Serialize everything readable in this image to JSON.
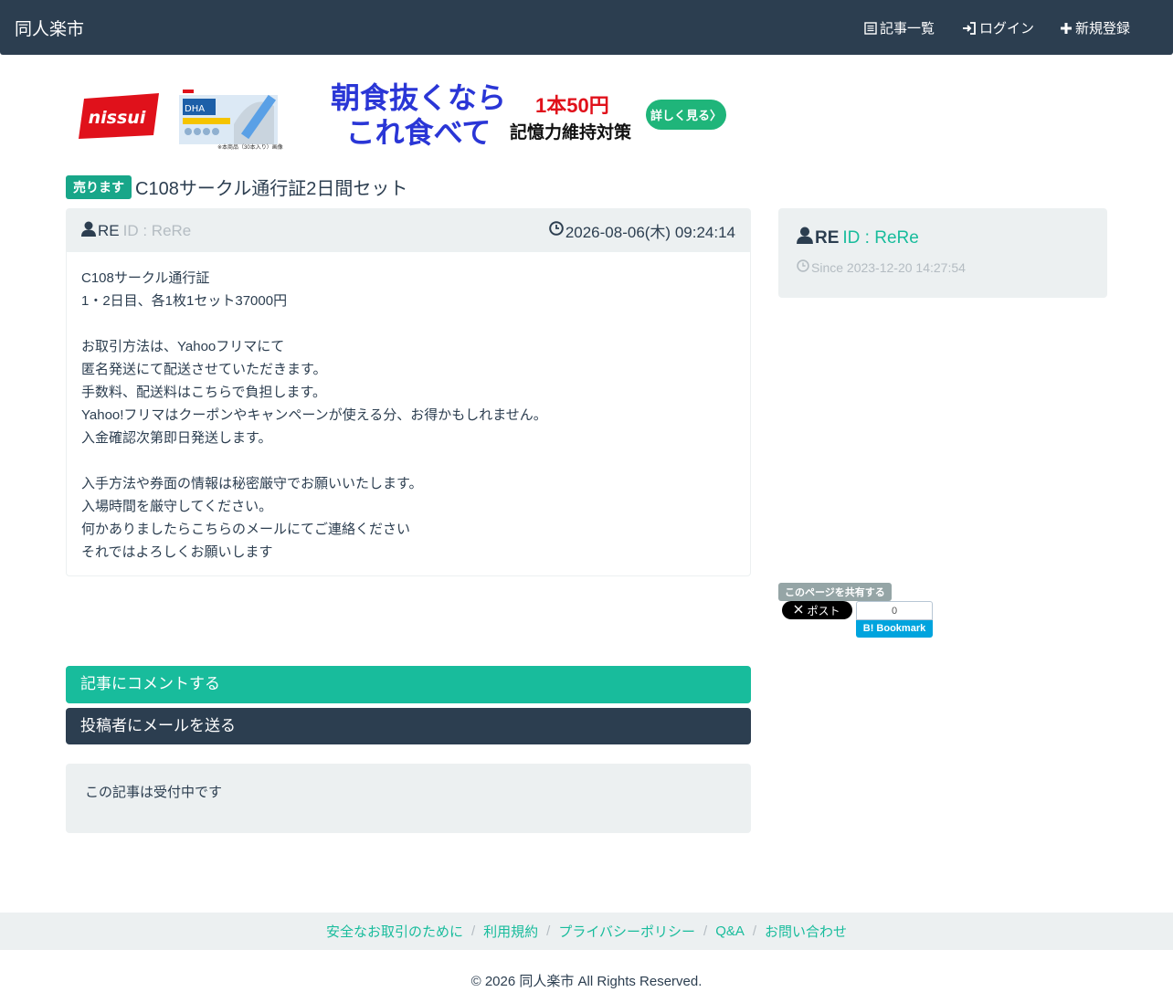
{
  "navbar": {
    "brand": "同人楽市",
    "links": [
      {
        "label": "記事一覧",
        "icon": "list-icon"
      },
      {
        "label": "ログイン",
        "icon": "login-icon"
      },
      {
        "label": "新規登録",
        "icon": "plus-icon"
      }
    ]
  },
  "ad": {
    "logo_text": "nissui",
    "product_caption": "※本商品（30本入り）画像",
    "headline_line1": "朝食抜くなら",
    "headline_line2": "これ食べて",
    "price": "1本50円",
    "subline": "記憶力維持対策",
    "button_label": "詳しく見る〉",
    "colors": {
      "headline": "#2a36d6",
      "price": "#e0111b",
      "button": "#1fb57a",
      "logo": "#e0111b"
    }
  },
  "article": {
    "badge": "売ります",
    "title": "C108サークル通行証2日間セット"
  },
  "post": {
    "author_name": "RE",
    "author_id": "ID : ReRe",
    "date": "2026-08-06(木) 09:24:14",
    "body_lines": [
      "C108サークル通行証",
      "1・2日目、各1枚1セット37000円",
      "",
      "お取引方法は、Yahooフリマにて",
      "匿名発送にて配送させていただきます。",
      "手数料、配送料はこちらで負担します。",
      "Yahoo!フリマはクーポンやキャンペーンが使える分、お得かもしれません。",
      "入金確認次第即日発送します。",
      "",
      "入手方法や券面の情報は秘密厳守でお願いいたします。",
      "入場時間を厳守してください。",
      "何かありましたらこちらのメールにてご連絡ください",
      "それではよろしくお願いします"
    ]
  },
  "profile": {
    "name": "RE",
    "id": "ID : ReRe",
    "since": "Since 2023-12-20 14:27:54"
  },
  "share": {
    "label": "このページを共有する",
    "x_post": "ポスト",
    "hatena_count": "0",
    "hatena_label": "B! Bookmark"
  },
  "actions": {
    "comment": "記事にコメントする",
    "mail": "投稿者にメールを送る"
  },
  "status": "この記事は受付中です",
  "footer": {
    "links": [
      "安全なお取引のために",
      "利用規約",
      "プライバシーポリシー",
      "Q&A",
      "お問い合わせ"
    ],
    "copyright": "© 2026 同人楽市 All Rights Reserved."
  }
}
